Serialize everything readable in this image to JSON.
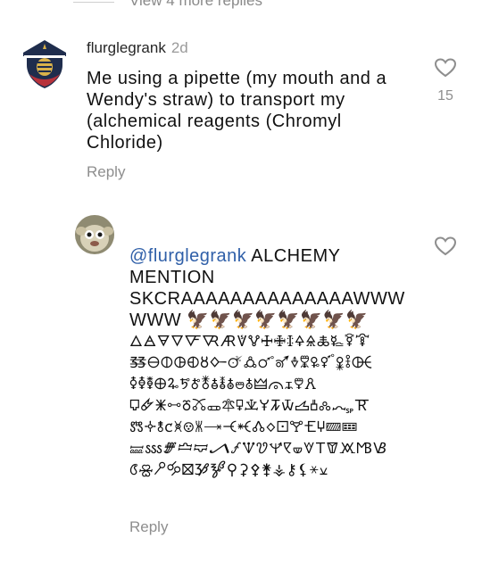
{
  "thread": {
    "more_replies_label": "View 4 more replies"
  },
  "comment1": {
    "username": "flurglegrank",
    "time": "2d",
    "lines": [
      "Me using a pipette (my mouth and a",
      "Wendy's straw) to transport my",
      "(alchemical reagents (Chromyl",
      "Chloride)"
    ],
    "reply_label": "Reply",
    "like_count": "15",
    "avatar_icon": "shield-beehive-icon",
    "heart_icon": "heart-outline-icon"
  },
  "comment2": {
    "mention": "@flurglegrank",
    "first_line_rest": " ALCHEMY",
    "lines": [
      "MENTION",
      "SKCRAAAAAAAAAAAAAAWWW",
      "WWW 🦅🦅🦅🦅🦅🦅🦅🦅",
      "🜂🜁🜃🜄🜅🜆🜇🜈🜉🜊🜋🜌🜍🜎🜏🜐🜑🜒",
      "🜓🜔🜕🜖🜗🜘🜙🜚🜛🜜🜝🜞🜟🜠🜡🜢🜣🜤",
      "🜥🜦🜧🜨🜩🜪🜫🜬🜭🜮🜯🜰🜱🜲🜳🜴🜵🜶",
      "🜷🜸🜹🜺🜻🜼🜽🜾🜿🝀🝁🝂🝃🝄🝅🝆🝇🝈",
      "🝉🝊🝋🝌🝍🝎🝏🝐🝑🝒🝓🝔🝕🝖🝗🝘🝙🝚",
      "🝛🝜🝝🝞🝟🝠🝡🝢🝣🝤🝥🝦🝧🝨🝩🝪🝫🝬",
      "🝭🝮🝯🝰🝱🝲🝳⚲⚳⚴⚵⚶⚷⚸⚹⚺"
    ],
    "reply_label": "Reply",
    "avatar_icon": "plush-doll-avatar",
    "heart_icon": "heart-outline-icon"
  }
}
